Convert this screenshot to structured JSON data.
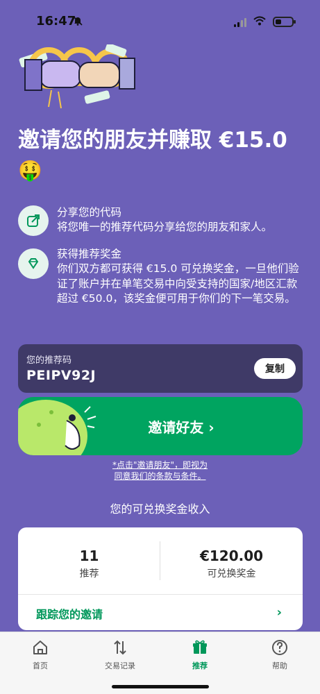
{
  "status_bar": {
    "time": "16:47"
  },
  "headline": {
    "text": "邀请您的朋友并赚取 €15.0",
    "emoji": "🤑"
  },
  "features": [
    {
      "title": "分享您的代码",
      "body": "将您唯一的推荐代码分享给您的朋友和家人。",
      "icon": "share-icon"
    },
    {
      "title": "获得推荐奖金",
      "body": "你们双方都可获得 €15.0 可兑换奖金，一旦他们验证了账户并在单笔交易中向受支持的国家/地区汇款超过 €50.0，该奖金便可用于你们的下一笔交易。",
      "icon": "diamond-icon"
    }
  ],
  "referral": {
    "label": "您的推荐码",
    "code": "PEIPV92J",
    "copy_label": "复制"
  },
  "invite": {
    "label": "邀请好友 ›"
  },
  "terms": {
    "line1": "*点击\"邀请朋友\"，即视为",
    "line2": "同意我们的条款与条件。"
  },
  "earnings": {
    "title": "您的可兑换奖金收入",
    "referrals_count": "11",
    "referrals_label": "推荐",
    "amount": "€120.00",
    "amount_label": "可兑换奖金",
    "track_label": "跟踪您的邀请",
    "track_chevron": "›"
  },
  "tabs": [
    {
      "label": "首页",
      "icon": "home-icon"
    },
    {
      "label": "交易记录",
      "icon": "transactions-icon"
    },
    {
      "label": "推荐",
      "icon": "gift-icon",
      "active": true
    },
    {
      "label": "帮助",
      "icon": "help-icon"
    }
  ],
  "colors": {
    "background": "#6c60b8",
    "accent": "#00a460",
    "card_dark": "#3f3a67"
  }
}
